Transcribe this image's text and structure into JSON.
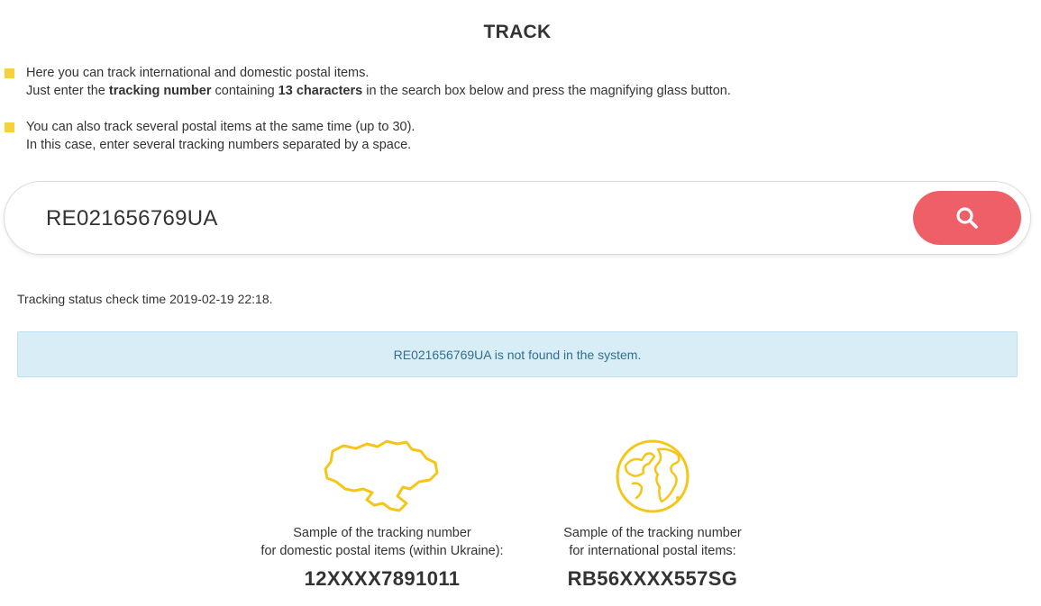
{
  "page": {
    "title": "TRACK"
  },
  "info": {
    "item1_line1": "Here you can track international and domestic postal items.",
    "item1_line2_prefix": "Just enter the ",
    "item1_line2_bold1": "tracking number",
    "item1_line2_mid": " containing ",
    "item1_line2_bold2": "13 characters",
    "item1_line2_suffix": " in the search box below and press the magnifying glass button.",
    "item2_line1": "You can also track several postal items at the same time (up to 30).",
    "item2_line2": "In this case, enter several tracking numbers separated by a space.",
    "bullet_color": "#f5d13a"
  },
  "search": {
    "value": "RE021656769UA",
    "button_icon": "search-icon",
    "button_color": "#ee5f67"
  },
  "status": {
    "check_time_text": "Tracking status check time 2019-02-19 22:18.",
    "alert_text": "RE021656769UA is not found in the system."
  },
  "samples": {
    "domestic": {
      "icon": "ukraine-map-icon",
      "caption_line1": "Sample of the tracking number",
      "caption_line2": "for domestic postal items (within Ukraine):",
      "number": "12XXXX7891011"
    },
    "international": {
      "icon": "globe-icon",
      "caption_line1": "Sample of the tracking number",
      "caption_line2": "for international postal items:",
      "number": "RB56XXXX557SG"
    },
    "icon_color": "#f5c518"
  }
}
